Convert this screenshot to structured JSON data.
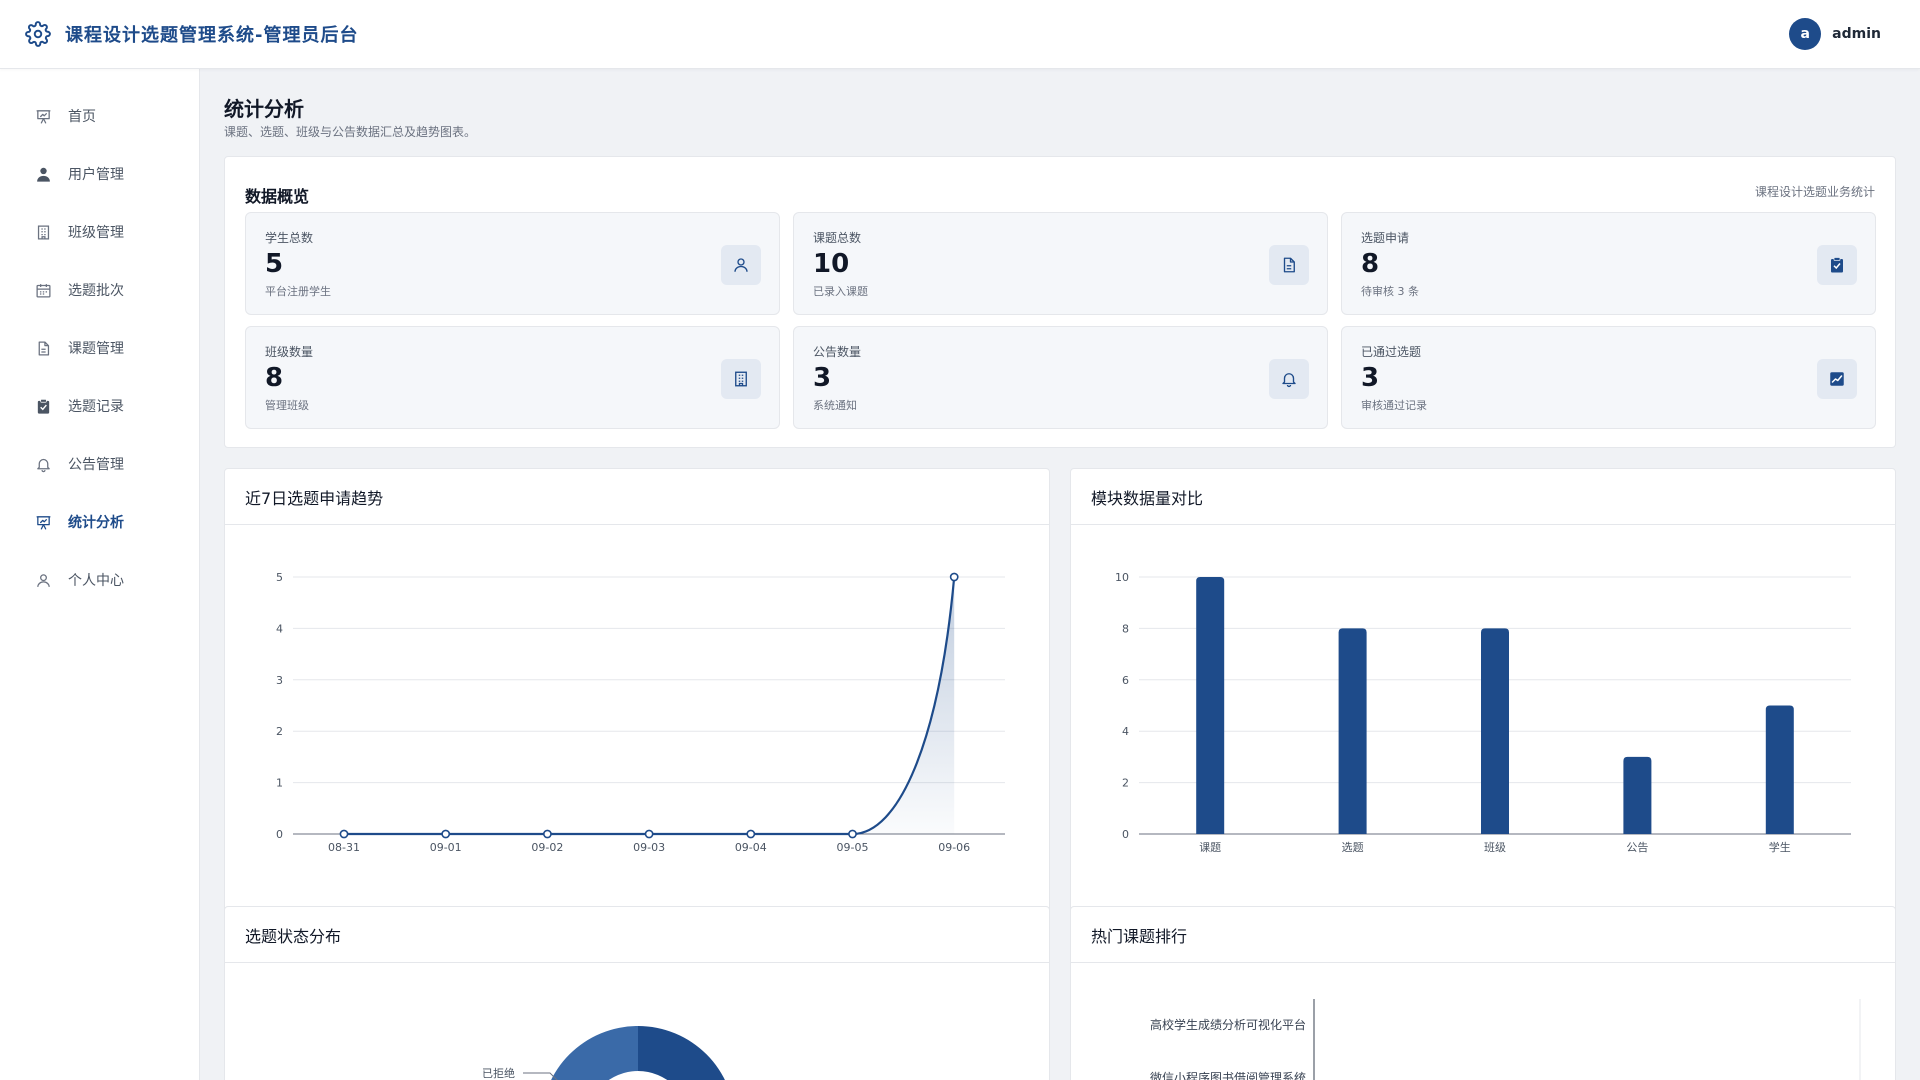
{
  "header": {
    "title": "课程设计选题管理系统-管理员后台",
    "avatar_letter": "a",
    "username": "admin"
  },
  "sidebar": {
    "items": [
      {
        "label": "首页",
        "icon": "presentation-icon"
      },
      {
        "label": "用户管理",
        "icon": "user-icon"
      },
      {
        "label": "班级管理",
        "icon": "building-icon"
      },
      {
        "label": "选题批次",
        "icon": "calendar-icon"
      },
      {
        "label": "课题管理",
        "icon": "document-icon"
      },
      {
        "label": "选题记录",
        "icon": "clipboard-check-icon"
      },
      {
        "label": "公告管理",
        "icon": "bell-icon"
      },
      {
        "label": "统计分析",
        "icon": "chart-presentation-icon",
        "active": true
      },
      {
        "label": "个人中心",
        "icon": "user-outline-icon"
      }
    ]
  },
  "page": {
    "title": "统计分析",
    "subtitle": "课题、选题、班级与公告数据汇总及趋势图表。"
  },
  "overview": {
    "title": "数据概览",
    "note": "课程设计选题业务统计",
    "stats": [
      {
        "label": "学生总数",
        "value": "5",
        "desc": "平台注册学生",
        "icon": "user-icon"
      },
      {
        "label": "课题总数",
        "value": "10",
        "desc": "已录入课题",
        "icon": "document-icon"
      },
      {
        "label": "选题申请",
        "value": "8",
        "desc": "待审核 3 条",
        "icon": "clipboard-check-icon"
      },
      {
        "label": "班级数量",
        "value": "8",
        "desc": "管理班级",
        "icon": "building-icon"
      },
      {
        "label": "公告数量",
        "value": "3",
        "desc": "系统通知",
        "icon": "bell-icon"
      },
      {
        "label": "已通过选题",
        "value": "3",
        "desc": "审核通过记录",
        "icon": "chart-up-icon"
      }
    ]
  },
  "cards": {
    "trend_title": "近7日选题申请趋势",
    "module_title": "模块数据量对比",
    "status_title": "选题状态分布",
    "ranking_title": "热门课题排行"
  },
  "colors": {
    "primary": "#1e4b8a",
    "primary_light": "#3a6aa8",
    "background": "#f0f2f5"
  },
  "chart_data": [
    {
      "type": "line",
      "title": "近7日选题申请趋势",
      "x": [
        "08-31",
        "09-01",
        "09-02",
        "09-03",
        "09-04",
        "09-05",
        "09-06"
      ],
      "values": [
        0,
        0,
        0,
        0,
        0,
        0,
        5
      ],
      "ylim": [
        0,
        5
      ],
      "yticks": [
        0,
        1,
        2,
        3,
        4,
        5
      ],
      "grid": true,
      "smooth": true,
      "area": true
    },
    {
      "type": "bar",
      "title": "模块数据量对比",
      "categories": [
        "课题",
        "选题",
        "班级",
        "公告",
        "学生"
      ],
      "values": [
        10,
        8,
        8,
        3,
        5
      ],
      "ylim": [
        0,
        10
      ],
      "yticks": [
        0,
        2,
        4,
        6,
        8,
        10
      ],
      "grid": true
    },
    {
      "type": "pie",
      "title": "选题状态分布",
      "visible_labels": [
        "已拒绝"
      ]
    },
    {
      "type": "bar",
      "orientation": "horizontal",
      "title": "热门课题排行",
      "categories": [
        "高校学生成绩分析可视化平台",
        "微信小程序图书借阅管理系统"
      ]
    }
  ]
}
